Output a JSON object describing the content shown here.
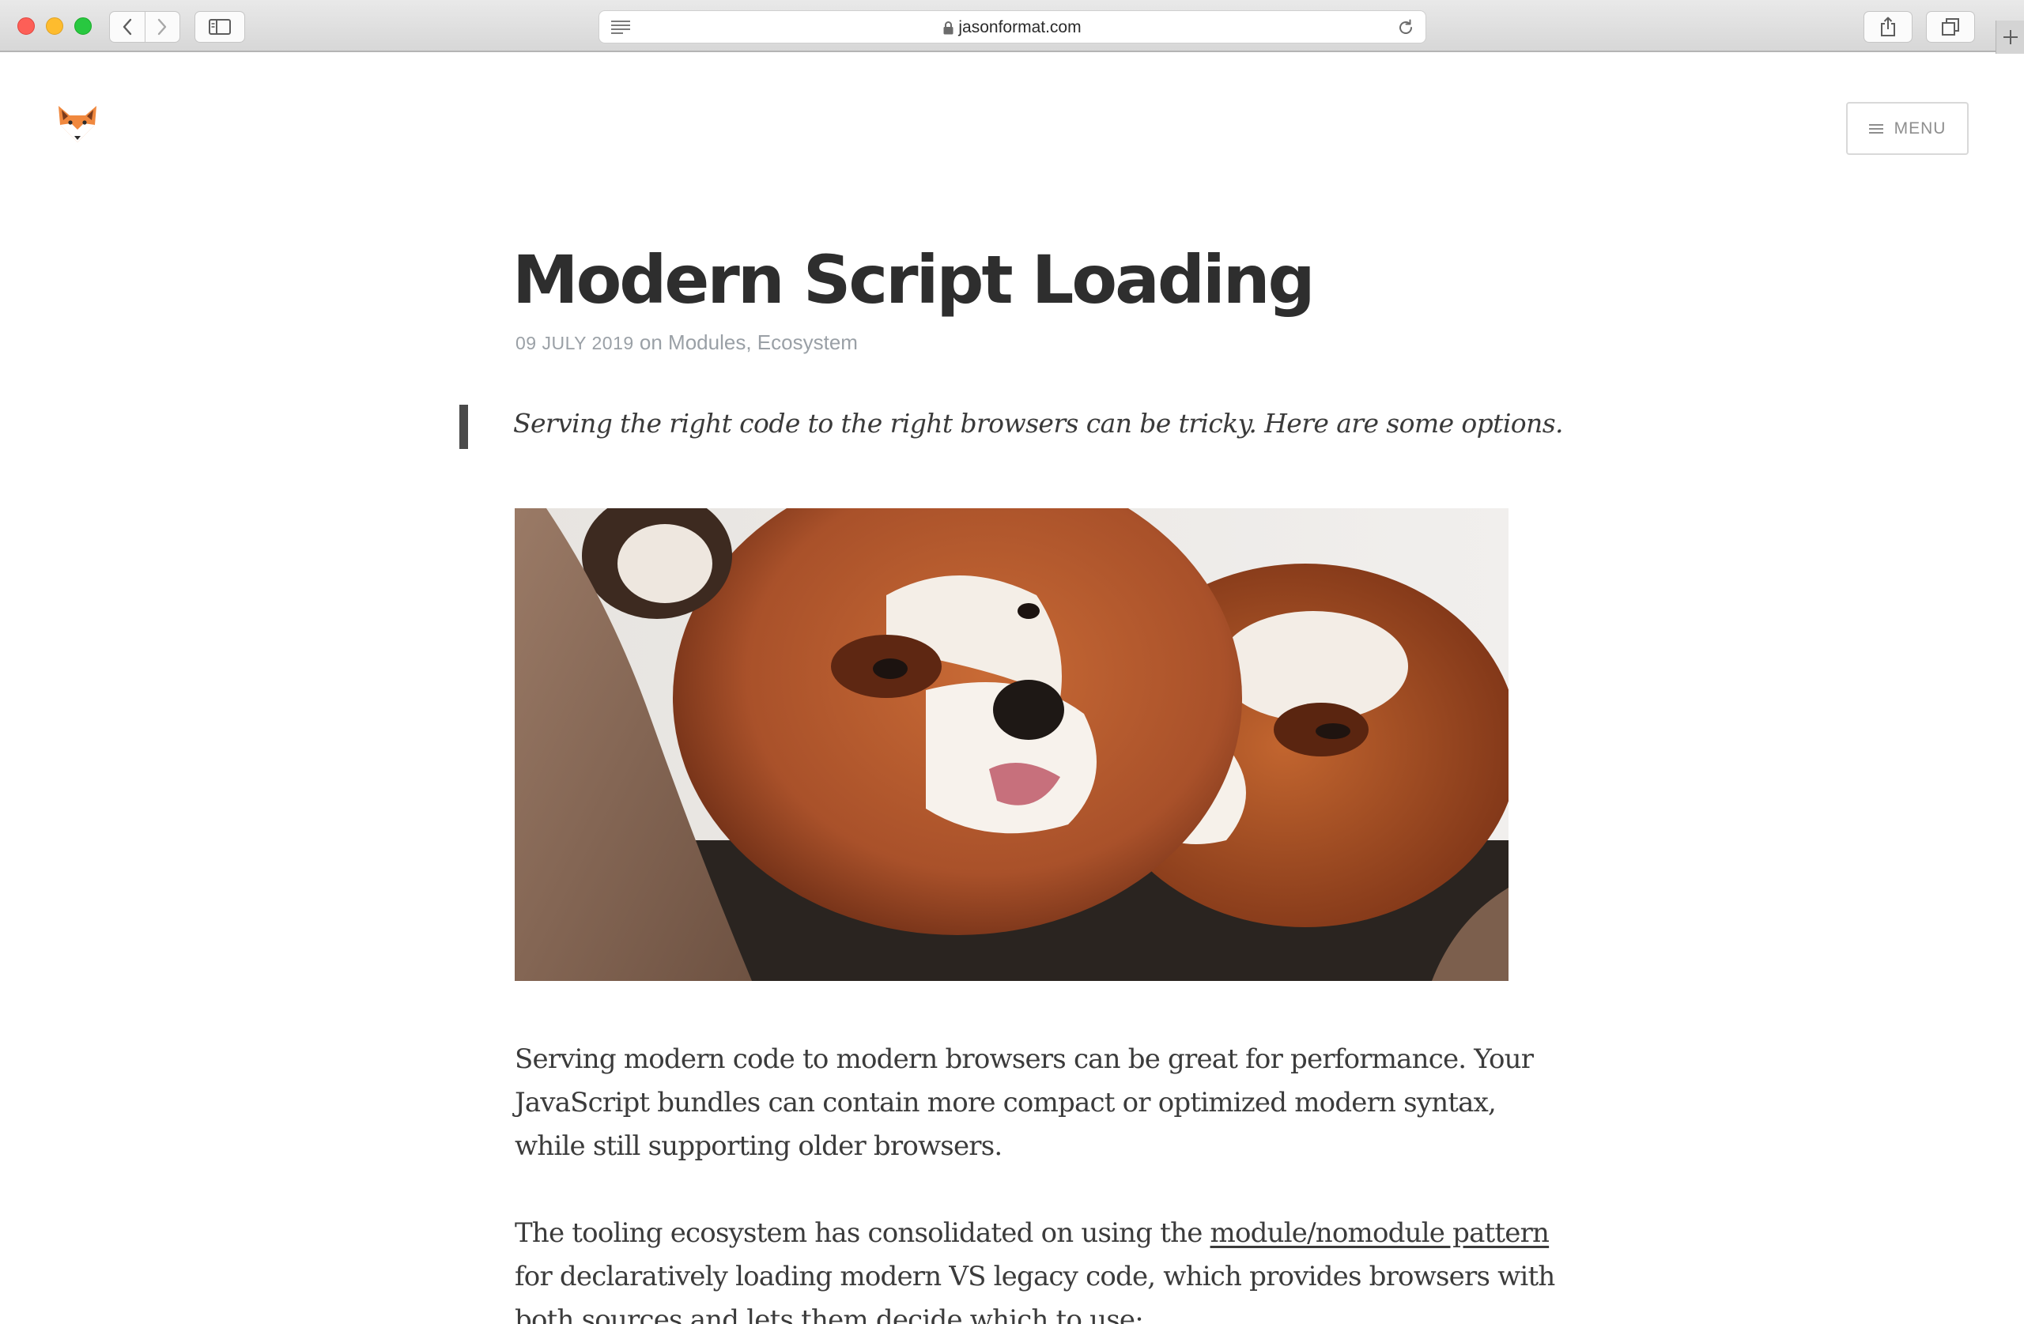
{
  "browser": {
    "url": "jasonformat.com",
    "icons": {
      "back": "chevron-left-icon",
      "forward": "chevron-right-icon",
      "sidebar": "sidebar-icon",
      "reader": "reader-view-icon",
      "lock": "lock-icon",
      "reload": "reload-icon",
      "share": "share-icon",
      "tabs": "tabs-overview-icon",
      "new_tab": "plus-icon"
    }
  },
  "header": {
    "logo_icon": "fox-logo-icon",
    "menu_label": "MENU"
  },
  "post": {
    "title": "Modern Script Loading",
    "date": "09 JULY 2019",
    "on": "on",
    "tags": [
      "Modules",
      "Ecosystem"
    ],
    "tag_separator": ",",
    "excerpt": "Serving the right code to the right browsers can be tricky. Here are some options.",
    "hero_image": "red-pandas-photo",
    "paragraphs": [
      {
        "lines": [
          "Serving modern code to modern browsers can be great for performance. Your",
          "JavaScript bundles can contain more compact or optimized modern syntax,",
          "while still supporting older browsers."
        ]
      },
      {
        "line1_before_link": "The tooling ecosystem has consolidated on using the ",
        "link_text": "module/nomodule pattern",
        "line2": "for declaratively loading modern VS legacy code, which provides browsers with",
        "line3": "both sources and lets them decide which to use:"
      }
    ]
  },
  "colors": {
    "title": "#2e2e2e",
    "meta": "#9aa0a6",
    "body_text": "#3b3b3b",
    "quote_bar": "#4a4a4a"
  }
}
